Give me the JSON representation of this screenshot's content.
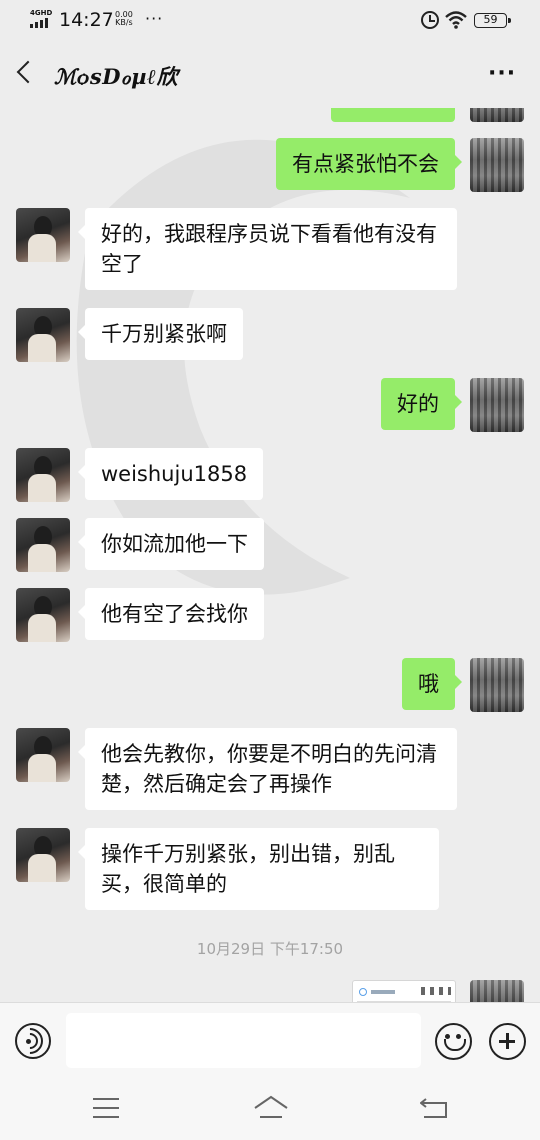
{
  "status_bar": {
    "network": "4GHD",
    "time": "14:27",
    "speed_value": "0.00",
    "speed_unit": "KB/s",
    "more": "···",
    "battery": "59"
  },
  "header": {
    "title": "ℳѻsDℴµℓ欣",
    "more": "···"
  },
  "messages": [
    {
      "side": "out",
      "text": "",
      "partial": true
    },
    {
      "side": "out",
      "text": "有点紧张怕不会"
    },
    {
      "side": "in",
      "text": "好的，我跟程序员说下看看他有没有空了"
    },
    {
      "side": "in",
      "text": "千万别紧张啊"
    },
    {
      "side": "out",
      "text": "好的"
    },
    {
      "side": "in",
      "text": "weishuju1858"
    },
    {
      "side": "in",
      "text": "你如流加他一下"
    },
    {
      "side": "in",
      "text": "他有空了会找你"
    },
    {
      "side": "out",
      "text": "哦"
    },
    {
      "side": "in",
      "text": "他会先教你，你要是不明白的先问清楚，然后确定会了再操作"
    },
    {
      "side": "in",
      "text": "操作千万别紧张，别出错，别乱买，很简单的"
    }
  ],
  "timestamp": "10月29日 下午17:50",
  "input": {
    "placeholder": "",
    "value": ""
  },
  "colors": {
    "sent_bubble": "#95ec69",
    "received_bubble": "#ffffff",
    "background": "#ededed"
  }
}
